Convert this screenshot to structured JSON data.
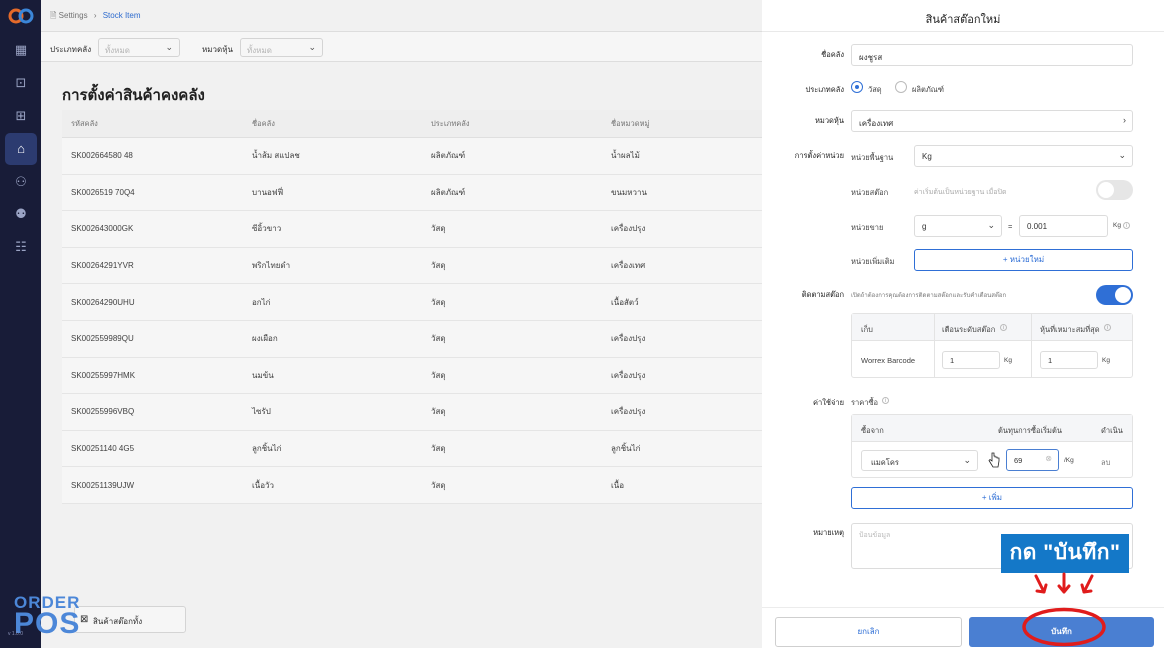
{
  "breadcrumb": {
    "settings": "Settings",
    "separator": "›",
    "current": "Stock Item"
  },
  "filters": [
    {
      "label": "ประเภทคลัง",
      "value": "ทั้งหมด"
    },
    {
      "label": "หมวดหุ้น",
      "value": "ทั้งหมด"
    }
  ],
  "page_title": "การตั้งค่าสินค้าคงคลัง",
  "table": {
    "columns": [
      "รหัสคลัง",
      "ชื่อคลัง",
      "ประเภทคลัง",
      "ชื่อหมวดหมู่"
    ],
    "rows": [
      [
        "SK002664580 48",
        "น้ำส้ม สแปลช",
        "ผลิตภัณฑ์",
        "น้ำผลไม้"
      ],
      [
        "SK0026519 70Q4",
        "บานอฟฟี่",
        "ผลิตภัณฑ์",
        "ขนมหวาน"
      ],
      [
        "SK002643000GK",
        "ซีอิ้วขาว",
        "วัสดุ",
        "เครื่องปรุง"
      ],
      [
        "SK00264291YVR",
        "พริกไทยดำ",
        "วัสดุ",
        "เครื่องเทศ"
      ],
      [
        "SK00264290UHU",
        "อกไก่",
        "วัสดุ",
        "เนื้อสัตว์"
      ],
      [
        "SK002559989QU",
        "ผงเผือก",
        "วัสดุ",
        "เครื่องปรุง"
      ],
      [
        "SK00255997HMK",
        "นมข้น",
        "วัสดุ",
        "เครื่องปรุง"
      ],
      [
        "SK00255996VBQ",
        "ไซรัป",
        "วัสดุ",
        "เครื่องปรุง"
      ],
      [
        "SK00251140 4G5",
        "ลูกชิ้นไก่",
        "วัสดุ",
        "ลูกชิ้นไก่"
      ],
      [
        "SK00251139UJW",
        "เนื้อวัว",
        "วัสดุ",
        "เนื้อ"
      ]
    ]
  },
  "footer_button": "สินค้าสต๊อกทั้ง",
  "brand": {
    "line1": "ORDER",
    "line2": "POS",
    "version": "v 1.0.0"
  },
  "panel": {
    "title": "สินค้าสต๊อกใหม่",
    "name_label": "ชื่อคลัง",
    "name_value": "ผงชูรส",
    "type_label": "ประเภทคลัง",
    "type_options": [
      "วัสดุ",
      "ผลิตภัณฑ์"
    ],
    "type_selected": "วัสดุ",
    "category_label": "หมวดหุ้น",
    "category_value": "เครื่องเทศ",
    "unit_settings_label": "การตั้งค่าหน่วย",
    "base_unit_label": "หน่วยพื้นฐาน",
    "base_unit_value": "Kg",
    "stock_unit_label": "หน่วยสต๊อก",
    "stock_unit_hint": "ค่าเริ่มต้นเป็นหน่วยฐาน เมื่อปิด",
    "stock_unit_toggle": false,
    "sale_unit_label": "หน่วยขาย",
    "sale_unit_value": "g",
    "equals": "=",
    "sale_ratio": "0.001",
    "sale_ratio_unit": "Kg",
    "extra_unit_label": "หน่วยเพิ่มเติม",
    "add_unit_button": "+ หน่วยใหม่",
    "track_stock_label": "ติดตามสต๊อก",
    "track_stock_hint": "เปิดถ้าต้องการคุณต้องการติดตามสต๊อกและรับคำเตือนสต๊อก",
    "track_stock_toggle": true,
    "stock_table": {
      "headers": [
        "เก็บ",
        "เตือนระดับสต๊อก",
        "หุ้นที่เหมาะสมที่สุด"
      ],
      "row": {
        "store": "Worrex Barcode",
        "alert": "1",
        "alert_unit": "Kg",
        "optimal": "1",
        "optimal_unit": "Kg"
      }
    },
    "cost_label": "ค่าใช้จ่าย",
    "purchase_price_label": "ราคาซื้อ",
    "cost_table": {
      "headers": [
        "ซื้อจาก",
        "ต้นทุนการซื้อเริ่มต้น",
        "ดำเนิน"
      ],
      "row": {
        "supplier": "แมคโคร",
        "price": "69",
        "price_unit": "/Kg",
        "action": "ลบ"
      }
    },
    "add_button": "+ เพิ่ม",
    "note_label": "หมายเหตุ",
    "note_placeholder": "ป้อนข้อมูล",
    "cancel_button": "ยกเลิก",
    "save_button": "บันทึก"
  },
  "annotation": {
    "text": "กด \"บันทึก\"",
    "color": "#1478c8",
    "mark_color": "#e01c1c"
  },
  "colors": {
    "sidebar": "#181c38",
    "accent": "#2f6fd6",
    "save": "#4a7fd2"
  }
}
